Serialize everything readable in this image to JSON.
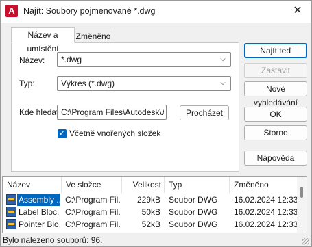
{
  "window": {
    "title": "Najít: Soubory pojmenované *.dwg",
    "app_icon_letter": "A",
    "close_glyph": "✕"
  },
  "tabs": [
    {
      "label": "Název a umístění",
      "active": true
    },
    {
      "label": "Změněno",
      "active": false
    }
  ],
  "form": {
    "name_label": "Název:",
    "name_value": "*.dwg",
    "type_label": "Typ:",
    "type_value": "Výkres (*.dwg)",
    "lookin_label": "Kde hledat:",
    "lookin_value": "C:\\Program Files\\Autodesk\\A",
    "browse_label": "Procházet",
    "subfolders_label": "Včetně vnořených složek",
    "subfolders_checked": true
  },
  "buttons": {
    "find_now": "Najít teď",
    "stop": "Zastavit",
    "new_search": "Nové vyhledávání",
    "ok": "OK",
    "cancel": "Storno",
    "help": "Nápověda"
  },
  "results": {
    "columns": [
      "Název",
      "Ve složce",
      "Velikost",
      "Typ",
      "Změněno"
    ],
    "rows": [
      {
        "name": "Assembly ...",
        "folder": "C:\\Program Fil...",
        "size": "229kB",
        "type": "Soubor DWG",
        "modified": "16.02.2024 12:33",
        "selected": true
      },
      {
        "name": "Label Bloc...",
        "folder": "C:\\Program Fil...",
        "size": "50kB",
        "type": "Soubor DWG",
        "modified": "16.02.2024 12:33",
        "selected": false
      },
      {
        "name": "Pointer Blo...",
        "folder": "C:\\Program Fil...",
        "size": "52kB",
        "type": "Soubor DWG",
        "modified": "16.02.2024 12:33",
        "selected": false
      }
    ]
  },
  "status": {
    "text": "Bylo nalezeno souborů: 96."
  },
  "colors": {
    "accent": "#0067c0",
    "app_icon": "#c8102e"
  }
}
